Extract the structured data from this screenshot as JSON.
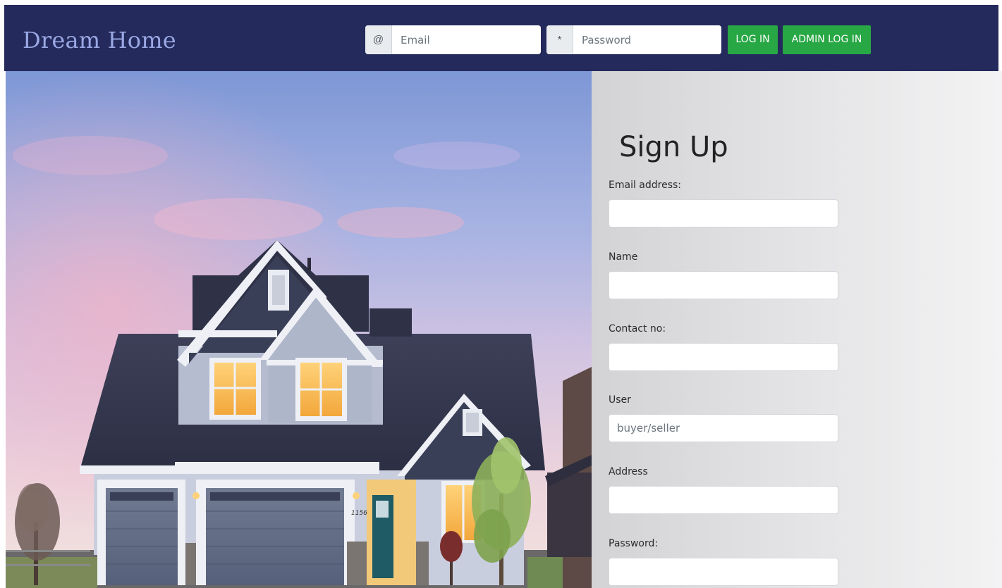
{
  "header": {
    "brand": "Dream Home",
    "email_addon": "@",
    "email_placeholder": "Email",
    "password_addon": "*",
    "password_placeholder": "Password",
    "login_label": "LOG IN",
    "admin_login_label": "ADMIN LOG IN"
  },
  "hero": {
    "house_number": "1156"
  },
  "signup": {
    "title": "Sign Up",
    "fields": [
      {
        "label": "Email address:",
        "placeholder": "",
        "value": ""
      },
      {
        "label": "Name",
        "placeholder": "",
        "value": ""
      },
      {
        "label": "Contact no:",
        "placeholder": "",
        "value": ""
      },
      {
        "label": "User",
        "placeholder": "buyer/seller",
        "value": ""
      },
      {
        "label": "Address",
        "placeholder": "",
        "value": ""
      },
      {
        "label": "Password:",
        "placeholder": "",
        "value": ""
      }
    ]
  },
  "colors": {
    "header_bg": "#242a5b",
    "brand_text": "#9aa8e4",
    "button_green": "#28a745"
  }
}
